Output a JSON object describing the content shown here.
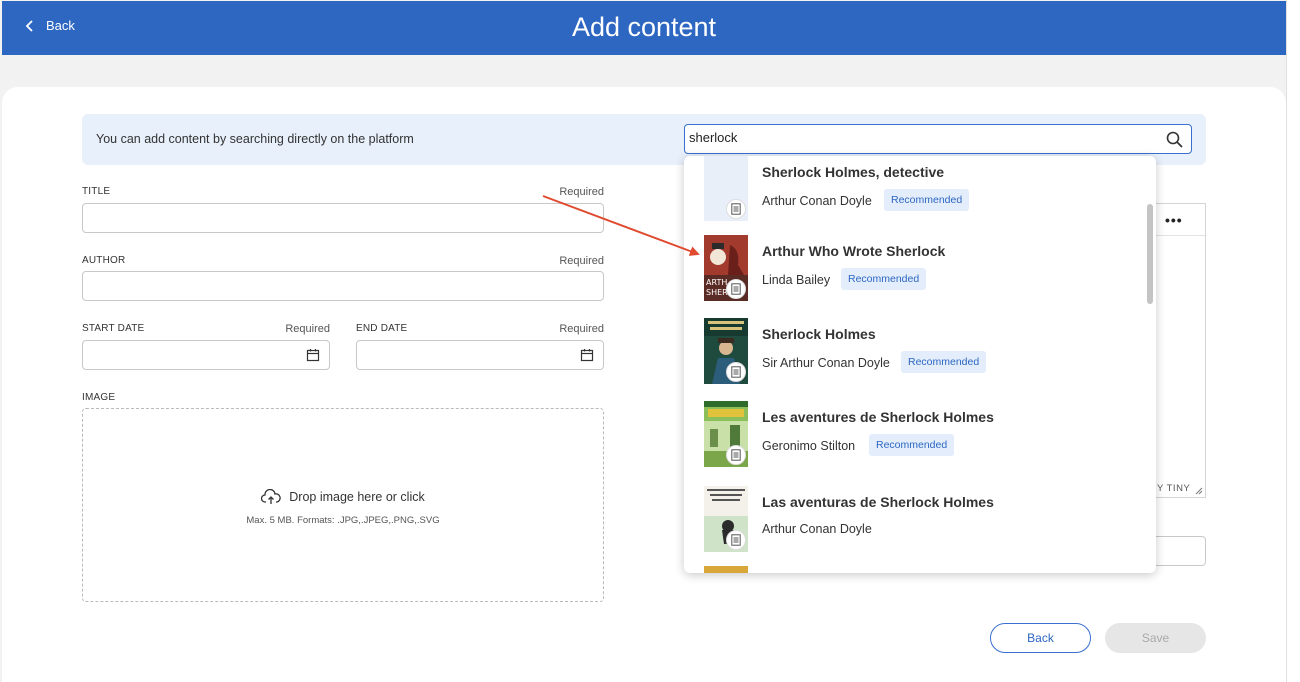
{
  "header": {
    "back_label": "Back",
    "title": "Add content",
    "bar_color": "#2d67c2"
  },
  "search": {
    "banner_text": "You can add content by searching directly on the platform",
    "query": "sherlock"
  },
  "form": {
    "title_label": "TITLE",
    "author_label": "AUTHOR",
    "start_date_label": "START DATE",
    "end_date_label": "END DATE",
    "image_label": "IMAGE",
    "required_text": "Required",
    "dropzone_text": "Drop image here or click",
    "dropzone_hint": "Max. 5 MB. Formats: .JPG,.JPEG,.PNG,.SVG"
  },
  "editor": {
    "brand_text": "Y TINY"
  },
  "results": [
    {
      "title": "Sherlock Holmes, detective",
      "author": "Arthur Conan Doyle",
      "tag": "Recommended",
      "cover": "blank"
    },
    {
      "title": "Arthur Who Wrote Sherlock",
      "author": "Linda Bailey",
      "tag": "Recommended",
      "cover": "red"
    },
    {
      "title": "Sherlock Holmes",
      "author": "Sir Arthur Conan Doyle",
      "tag": "Recommended",
      "cover": "green"
    },
    {
      "title": "Les aventures de Sherlock Holmes",
      "author": "Geronimo Stilton",
      "tag": "Recommended",
      "cover": "colorful"
    },
    {
      "title": "Las aventuras de Sherlock Holmes",
      "author": "Arthur Conan Doyle",
      "tag": "",
      "cover": "sketch"
    }
  ],
  "footer": {
    "back_label": "Back",
    "save_label": "Save"
  }
}
